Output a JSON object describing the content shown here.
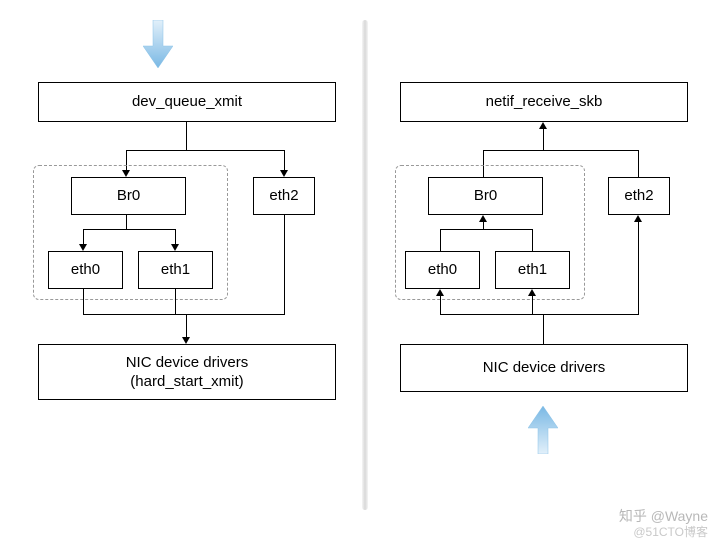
{
  "left": {
    "top_box": "dev_queue_xmit",
    "br0": "Br0",
    "eth0": "eth0",
    "eth1": "eth1",
    "eth2": "eth2",
    "bottom_box": "NIC device drivers\n(hard_start_xmit)"
  },
  "right": {
    "top_box": "netif_receive_skb",
    "br0": "Br0",
    "eth0": "eth0",
    "eth1": "eth1",
    "eth2": "eth2",
    "bottom_box": "NIC device drivers"
  },
  "watermark": {
    "line1": "知乎 @Wayne",
    "line2": "@51CTO博客"
  },
  "colors": {
    "arrow_fill": "#8dc3ea",
    "arrow_stroke": "#6fb3e0"
  }
}
